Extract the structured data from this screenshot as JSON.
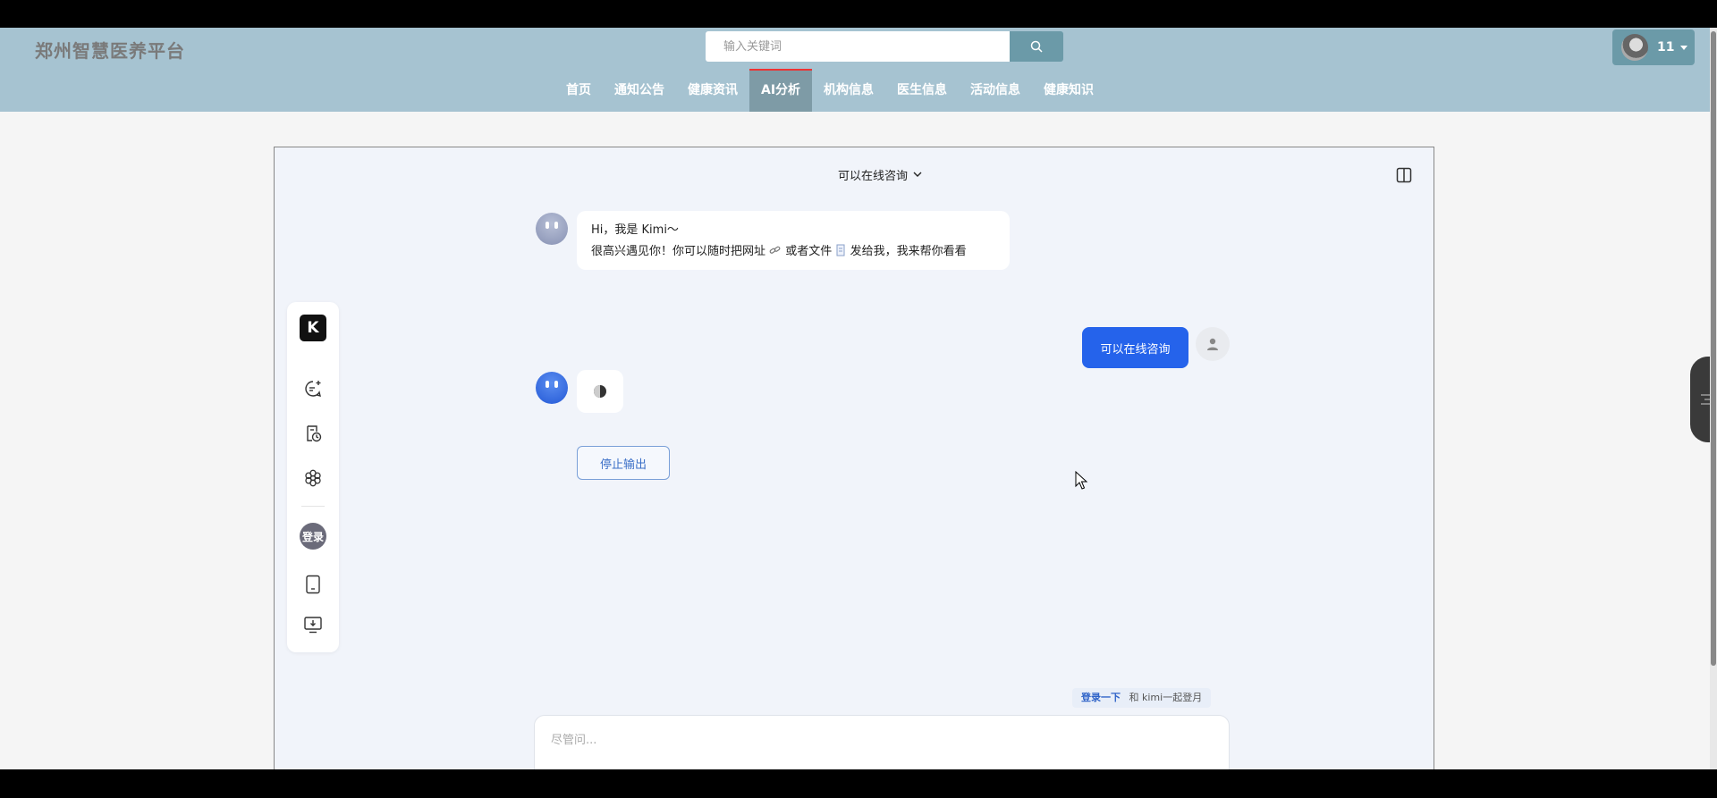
{
  "header": {
    "brand": "郑州智慧医养平台",
    "search_placeholder": "输入关键词",
    "nav": [
      {
        "label": "首页",
        "active": false
      },
      {
        "label": "通知公告",
        "active": false
      },
      {
        "label": "健康资讯",
        "active": false
      },
      {
        "label": "AI分析",
        "active": true
      },
      {
        "label": "机构信息",
        "active": false
      },
      {
        "label": "医生信息",
        "active": false
      },
      {
        "label": "活动信息",
        "active": false
      },
      {
        "label": "健康知识",
        "active": false
      }
    ],
    "user_name": "11"
  },
  "chat": {
    "title": "可以在线咨询",
    "greeting_line1": "Hi，我是 Kimi～",
    "greeting_line2a": "很高兴遇见你！你可以随时把网址",
    "greeting_line2b": "或者文件",
    "greeting_line2c": "发给我，我来帮你看看",
    "user_message": "可以在线咨询",
    "stop_label": "停止输出",
    "sidebar_login": "登录",
    "sidebar_logo": "K",
    "login_tip_link": "登录一下",
    "login_tip_text": "和 kimi一起登月",
    "input_placeholder": "尽管问..."
  },
  "colors": {
    "header_bg": "#a6c3d1",
    "accent_blue": "#2563eb",
    "active_tab_border": "#ee3333"
  }
}
